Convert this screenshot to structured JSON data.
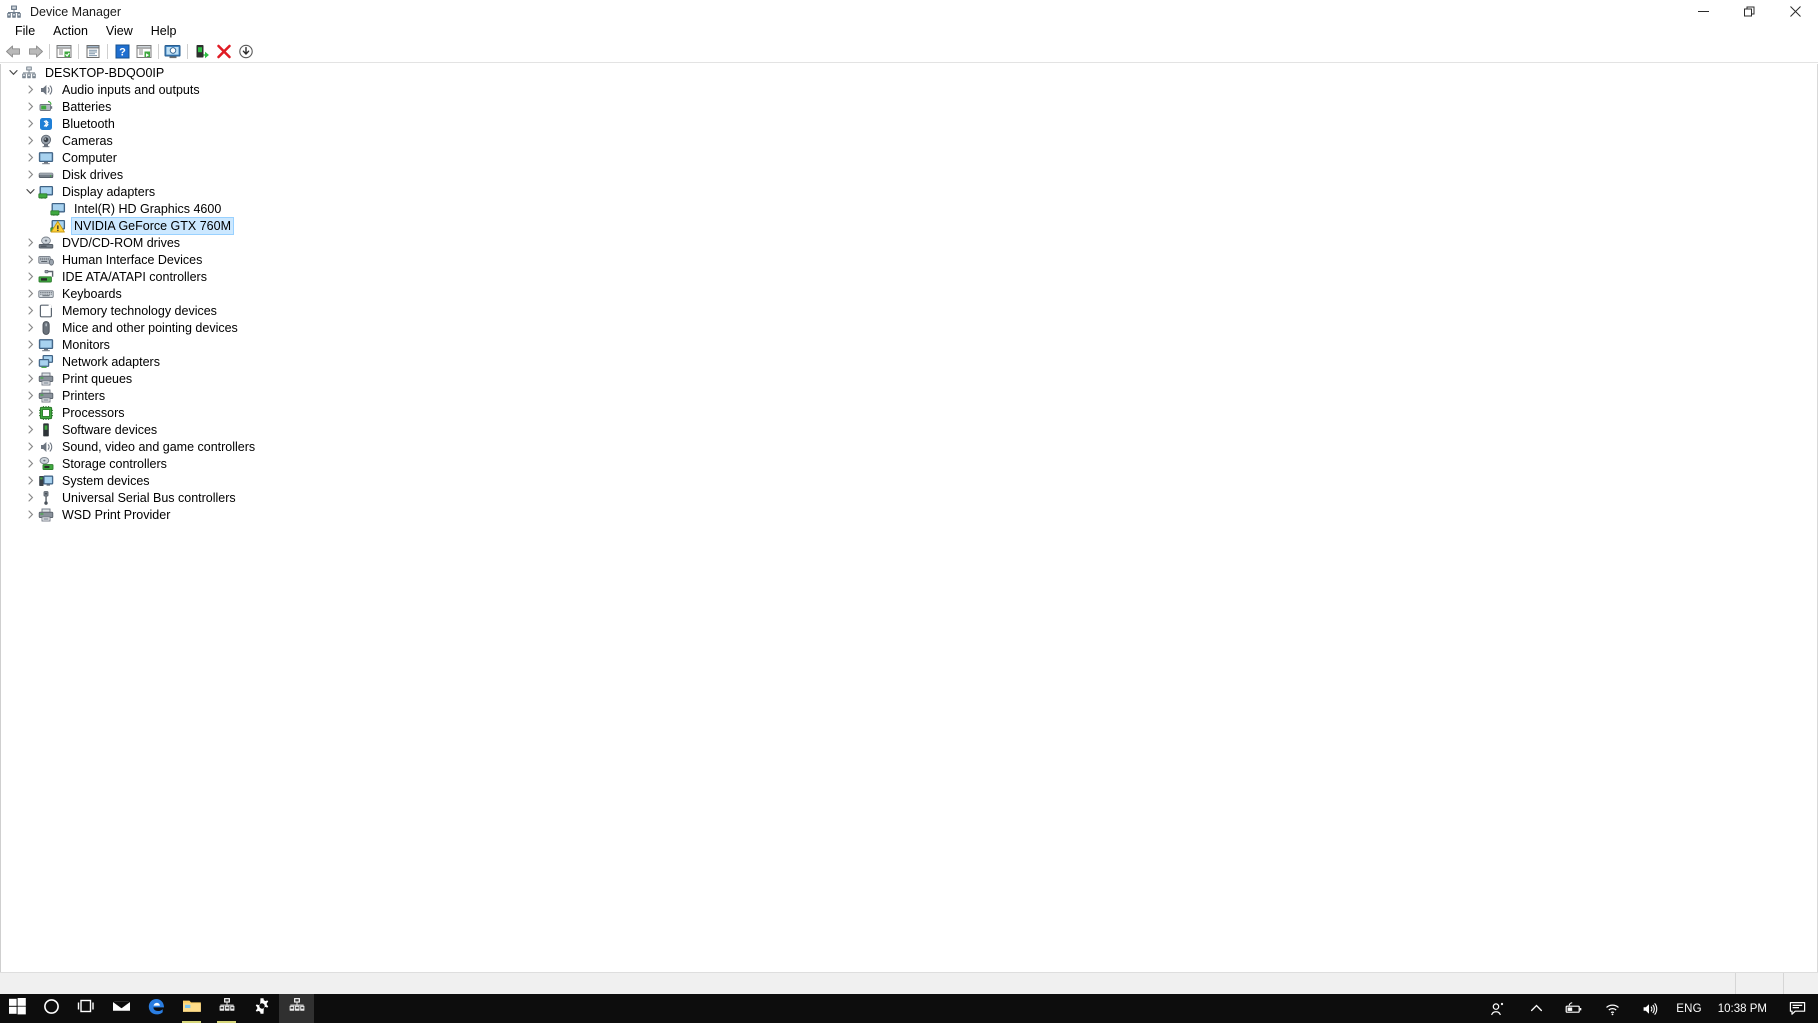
{
  "window": {
    "title": "Device Manager",
    "icon": "device-manager-icon",
    "controls": {
      "minimize": "minimize-icon",
      "restore": "restore-icon",
      "close": "close-icon"
    }
  },
  "menu": {
    "items": [
      {
        "label": "File",
        "name": "menu-file"
      },
      {
        "label": "Action",
        "name": "menu-action"
      },
      {
        "label": "View",
        "name": "menu-view"
      },
      {
        "label": "Help",
        "name": "menu-help"
      }
    ]
  },
  "toolbar": {
    "buttons": [
      {
        "icon": "back-arrow-icon",
        "tooltip": "Back"
      },
      {
        "icon": "forward-arrow-icon",
        "tooltip": "Forward"
      },
      {
        "icon": "show-hide-console-tree-icon",
        "tooltip": "Show/Hide Console Tree"
      },
      {
        "icon": "properties-icon",
        "tooltip": "Properties"
      },
      {
        "icon": "help-icon",
        "tooltip": "Help"
      },
      {
        "icon": "update-driver-icon",
        "tooltip": "Update Driver Software"
      },
      {
        "icon": "scan-hardware-changes-icon",
        "tooltip": "Scan for hardware changes"
      },
      {
        "icon": "enable-device-icon",
        "tooltip": "Enable device"
      },
      {
        "icon": "uninstall-device-icon",
        "tooltip": "Uninstall device"
      },
      {
        "icon": "disable-device-icon",
        "tooltip": "Disable device"
      }
    ]
  },
  "tree": {
    "nodes": [
      {
        "label": "DESKTOP-BDQO0IP",
        "depth": 0,
        "state": "expanded",
        "icon": "computer-root-icon",
        "selected": false
      },
      {
        "label": "Audio inputs and outputs",
        "depth": 1,
        "state": "collapsed",
        "icon": "speaker-icon",
        "selected": false
      },
      {
        "label": "Batteries",
        "depth": 1,
        "state": "collapsed",
        "icon": "battery-icon",
        "selected": false
      },
      {
        "label": "Bluetooth",
        "depth": 1,
        "state": "collapsed",
        "icon": "bluetooth-icon",
        "selected": false
      },
      {
        "label": "Cameras",
        "depth": 1,
        "state": "collapsed",
        "icon": "camera-icon",
        "selected": false
      },
      {
        "label": "Computer",
        "depth": 1,
        "state": "collapsed",
        "icon": "monitor-icon",
        "selected": false
      },
      {
        "label": "Disk drives",
        "depth": 1,
        "state": "collapsed",
        "icon": "disk-drive-icon",
        "selected": false
      },
      {
        "label": "Display adapters",
        "depth": 1,
        "state": "expanded",
        "icon": "display-adapter-icon",
        "selected": false
      },
      {
        "label": "Intel(R) HD Graphics 4600",
        "depth": 2,
        "state": "leaf",
        "icon": "display-adapter-icon",
        "selected": false
      },
      {
        "label": "NVIDIA GeForce GTX 760M",
        "depth": 2,
        "state": "leaf",
        "icon": "display-adapter-warning-icon",
        "selected": true
      },
      {
        "label": "DVD/CD-ROM drives",
        "depth": 1,
        "state": "collapsed",
        "icon": "optical-drive-icon",
        "selected": false
      },
      {
        "label": "Human Interface Devices",
        "depth": 1,
        "state": "collapsed",
        "icon": "hid-icon",
        "selected": false
      },
      {
        "label": "IDE ATA/ATAPI controllers",
        "depth": 1,
        "state": "collapsed",
        "icon": "ide-controller-icon",
        "selected": false
      },
      {
        "label": "Keyboards",
        "depth": 1,
        "state": "collapsed",
        "icon": "keyboard-icon",
        "selected": false
      },
      {
        "label": "Memory technology devices",
        "depth": 1,
        "state": "collapsed",
        "icon": "memory-device-icon",
        "selected": false
      },
      {
        "label": "Mice and other pointing devices",
        "depth": 1,
        "state": "collapsed",
        "icon": "mouse-icon",
        "selected": false
      },
      {
        "label": "Monitors",
        "depth": 1,
        "state": "collapsed",
        "icon": "monitor-icon",
        "selected": false
      },
      {
        "label": "Network adapters",
        "depth": 1,
        "state": "collapsed",
        "icon": "network-adapter-icon",
        "selected": false
      },
      {
        "label": "Print queues",
        "depth": 1,
        "state": "collapsed",
        "icon": "printer-icon",
        "selected": false
      },
      {
        "label": "Printers",
        "depth": 1,
        "state": "collapsed",
        "icon": "printer-icon",
        "selected": false
      },
      {
        "label": "Processors",
        "depth": 1,
        "state": "collapsed",
        "icon": "processor-icon",
        "selected": false
      },
      {
        "label": "Software devices",
        "depth": 1,
        "state": "collapsed",
        "icon": "software-device-icon",
        "selected": false
      },
      {
        "label": "Sound, video and game controllers",
        "depth": 1,
        "state": "collapsed",
        "icon": "speaker-icon",
        "selected": false
      },
      {
        "label": "Storage controllers",
        "depth": 1,
        "state": "collapsed",
        "icon": "storage-controller-icon",
        "selected": false
      },
      {
        "label": "System devices",
        "depth": 1,
        "state": "collapsed",
        "icon": "system-device-icon",
        "selected": false
      },
      {
        "label": "Universal Serial Bus controllers",
        "depth": 1,
        "state": "collapsed",
        "icon": "usb-icon",
        "selected": false
      },
      {
        "label": "WSD Print Provider",
        "depth": 1,
        "state": "collapsed",
        "icon": "printer-icon",
        "selected": false
      }
    ]
  },
  "statusbar": {
    "text": "",
    "panes": [
      "",
      "",
      ""
    ]
  },
  "taskbar": {
    "buttons": [
      {
        "icon": "windows-start-icon",
        "name": "start-button",
        "state": "normal"
      },
      {
        "icon": "cortana-circle-icon",
        "name": "cortana-button",
        "state": "normal"
      },
      {
        "icon": "task-view-icon",
        "name": "task-view-button",
        "state": "normal"
      },
      {
        "icon": "mail-icon",
        "name": "mail-button",
        "state": "normal"
      },
      {
        "icon": "edge-icon",
        "name": "edge-button",
        "state": "normal"
      },
      {
        "icon": "file-explorer-icon",
        "name": "file-explorer-button",
        "state": "running"
      },
      {
        "icon": "device-manager-icon",
        "name": "device-manager-pinned-button",
        "state": "running"
      },
      {
        "icon": "settings-gear-icon",
        "name": "settings-button",
        "state": "normal"
      },
      {
        "icon": "device-manager-icon",
        "name": "device-manager-active-button",
        "state": "active"
      }
    ],
    "tray": {
      "people": "people-icon",
      "chevron": "show-hidden-icons-icon",
      "battery": "battery-icon",
      "network": "wifi-icon",
      "volume": "speaker-icon",
      "language": "ENG",
      "clock": "10:38 PM",
      "notifications": "action-center-icon"
    }
  },
  "colors": {
    "selection_fill": "#cce8ff",
    "selection_border": "#99d1ff",
    "taskbar_bg": "#0d0d0d",
    "status_bg": "#f0f0f0",
    "warning_yellow": "#ffd23a",
    "edge_blue": "#2a7de1",
    "close_red": "#e81123"
  }
}
